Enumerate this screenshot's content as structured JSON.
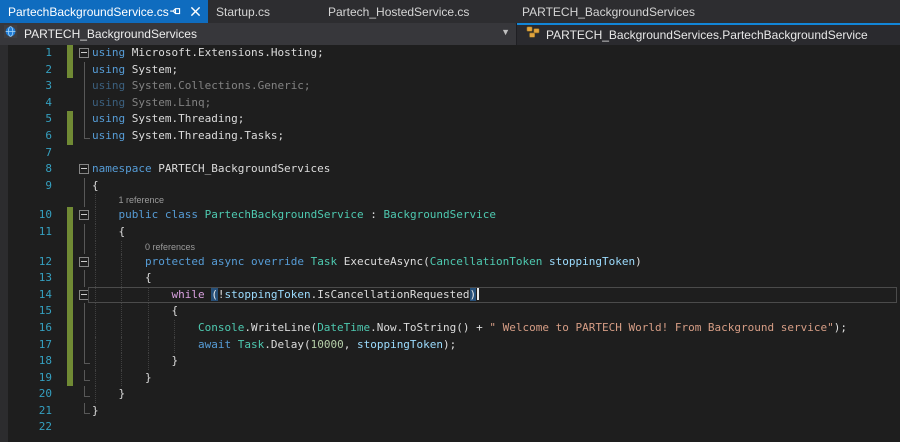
{
  "tabs": [
    {
      "label": "PartechBackgroundService.cs",
      "active": true,
      "pinned": true,
      "icons": [
        "pin-icon",
        "close-icon"
      ]
    },
    {
      "label": "Startup.cs",
      "active": false
    },
    {
      "label": "Partech_HostedService.cs",
      "active": false
    },
    {
      "label": "PARTECH_BackgroundServices",
      "active": false
    }
  ],
  "navbar": {
    "project": "PARTECH_BackgroundServices",
    "project_icon": "project-icon",
    "dropdown_icon": "chevron-down-icon",
    "member": "PARTECH_BackgroundServices.PartechBackgroundService",
    "member_icon": "class-icon"
  },
  "colors": {
    "active_tab": "#0f6cbf",
    "accent_line": "#1286d8",
    "tab_bar_bg": "#2d2d30",
    "editor_bg": "#1e1e1e",
    "line_number": "#35a0c0",
    "change_bar_green": "#708a34",
    "keyword": "#569cd6",
    "control_keyword": "#d8a0df",
    "type": "#4ec9b0",
    "string": "#d69d85",
    "number": "#b5cea8",
    "text": "#dcdcdc",
    "parameter": "#9cdcfe",
    "brace_match_bg": "#264f78",
    "codelens_text": "#9b9b9b"
  },
  "code": {
    "last_line_number": 22,
    "rows": [
      {
        "n": 1,
        "chg": true,
        "fold": "open",
        "segs": [
          [
            "using",
            "kw"
          ],
          [
            " Microsoft.Extensions.Hosting;",
            "pl"
          ]
        ]
      },
      {
        "n": 2,
        "chg": true,
        "fold": "line",
        "segs": [
          [
            "using",
            "kw"
          ],
          [
            " System;",
            "pl"
          ]
        ]
      },
      {
        "n": 3,
        "fold": "line",
        "dim": true,
        "segs": [
          [
            "using",
            "kw"
          ],
          [
            " System.Collections.Generic;",
            "pl"
          ]
        ]
      },
      {
        "n": 4,
        "fold": "line",
        "dim": true,
        "segs": [
          [
            "using",
            "kw"
          ],
          [
            " System.Linq;",
            "pl"
          ]
        ]
      },
      {
        "n": 5,
        "chg": true,
        "fold": "line",
        "segs": [
          [
            "using",
            "kw"
          ],
          [
            " System.Threading;",
            "pl"
          ]
        ]
      },
      {
        "n": 6,
        "chg": true,
        "fold": "end",
        "segs": [
          [
            "using",
            "kw"
          ],
          [
            " System.Threading.Tasks;",
            "pl"
          ]
        ]
      },
      {
        "n": 7,
        "segs": []
      },
      {
        "n": 8,
        "fold": "open",
        "segs": [
          [
            "namespace",
            "kw"
          ],
          [
            " PARTECH_BackgroundServices",
            "pl"
          ]
        ]
      },
      {
        "n": 9,
        "fold": "line",
        "segs": [
          [
            "{",
            "pl"
          ]
        ]
      },
      {
        "lens": "1 reference",
        "col": 4,
        "fold": "line",
        "guides": [
          0
        ]
      },
      {
        "n": 10,
        "chg": true,
        "fold": "open",
        "guides": [
          0
        ],
        "segs": [
          [
            "    ",
            "pl"
          ],
          [
            "public",
            "kw"
          ],
          [
            " ",
            "pl"
          ],
          [
            "class",
            "kw"
          ],
          [
            " ",
            "pl"
          ],
          [
            "PartechBackgroundService",
            "ty"
          ],
          [
            " : ",
            "pl"
          ],
          [
            "BackgroundService",
            "ty"
          ]
        ]
      },
      {
        "n": 11,
        "chg": true,
        "fold": "line",
        "guides": [
          0
        ],
        "segs": [
          [
            "    {",
            "pl"
          ]
        ]
      },
      {
        "lens": "0 references",
        "col": 8,
        "chg": true,
        "fold": "line",
        "guides": [
          0,
          4
        ]
      },
      {
        "n": 12,
        "chg": true,
        "fold": "open",
        "guides": [
          0,
          4
        ],
        "segs": [
          [
            "        ",
            "pl"
          ],
          [
            "protected",
            "kw"
          ],
          [
            " ",
            "pl"
          ],
          [
            "async",
            "kw"
          ],
          [
            " ",
            "pl"
          ],
          [
            "override",
            "kw"
          ],
          [
            " ",
            "pl"
          ],
          [
            "Task",
            "ty"
          ],
          [
            " ExecuteAsync(",
            "pl"
          ],
          [
            "CancellationToken",
            "ty"
          ],
          [
            " ",
            "pl"
          ],
          [
            "stoppingToken",
            "pa"
          ],
          [
            ")",
            "pl"
          ]
        ]
      },
      {
        "n": 13,
        "chg": true,
        "fold": "line",
        "guides": [
          0,
          4
        ],
        "segs": [
          [
            "        {",
            "pl"
          ]
        ]
      },
      {
        "n": 14,
        "chg": true,
        "fold": "open",
        "cur": true,
        "guides": [
          0,
          4,
          8
        ],
        "segs": [
          [
            "            ",
            "pl"
          ],
          [
            "while",
            "ct"
          ],
          [
            " ",
            "pl"
          ],
          [
            "(",
            "hl"
          ],
          [
            "!",
            "pl"
          ],
          [
            "stoppingToken",
            "pa"
          ],
          [
            ".IsCancellationRequested",
            "pl"
          ],
          [
            ")",
            "hl"
          ],
          [
            "",
            "cr"
          ]
        ]
      },
      {
        "n": 15,
        "chg": true,
        "fold": "line",
        "guides": [
          0,
          4,
          8
        ],
        "segs": [
          [
            "            {",
            "pl"
          ]
        ]
      },
      {
        "n": 16,
        "chg": true,
        "fold": "line",
        "guides": [
          0,
          4,
          8,
          12
        ],
        "segs": [
          [
            "                ",
            "pl"
          ],
          [
            "Console",
            "ty"
          ],
          [
            ".WriteLine(",
            "pl"
          ],
          [
            "DateTime",
            "ty"
          ],
          [
            ".Now.ToString() + ",
            "pl"
          ],
          [
            "\" Welcome to PARTECH World! From Background service\"",
            "st"
          ],
          [
            ");",
            "pl"
          ]
        ]
      },
      {
        "n": 17,
        "chg": true,
        "fold": "line",
        "guides": [
          0,
          4,
          8,
          12
        ],
        "segs": [
          [
            "                ",
            "pl"
          ],
          [
            "await",
            "kw"
          ],
          [
            " ",
            "pl"
          ],
          [
            "Task",
            "ty"
          ],
          [
            ".Delay(",
            "pl"
          ],
          [
            "10000",
            "nu"
          ],
          [
            ", ",
            "pl"
          ],
          [
            "stoppingToken",
            "pa"
          ],
          [
            ");",
            "pl"
          ]
        ]
      },
      {
        "n": 18,
        "chg": true,
        "fold": "end",
        "guides": [
          0,
          4,
          8
        ],
        "segs": [
          [
            "            }",
            "pl"
          ]
        ]
      },
      {
        "n": 19,
        "chg": true,
        "fold": "end",
        "guides": [
          0,
          4
        ],
        "segs": [
          [
            "        }",
            "pl"
          ]
        ]
      },
      {
        "n": 20,
        "fold": "end",
        "guides": [
          0
        ],
        "segs": [
          [
            "    }",
            "pl"
          ]
        ]
      },
      {
        "n": 21,
        "fold": "end",
        "segs": [
          [
            "}",
            "pl"
          ]
        ]
      },
      {
        "n": 22,
        "segs": []
      }
    ]
  }
}
